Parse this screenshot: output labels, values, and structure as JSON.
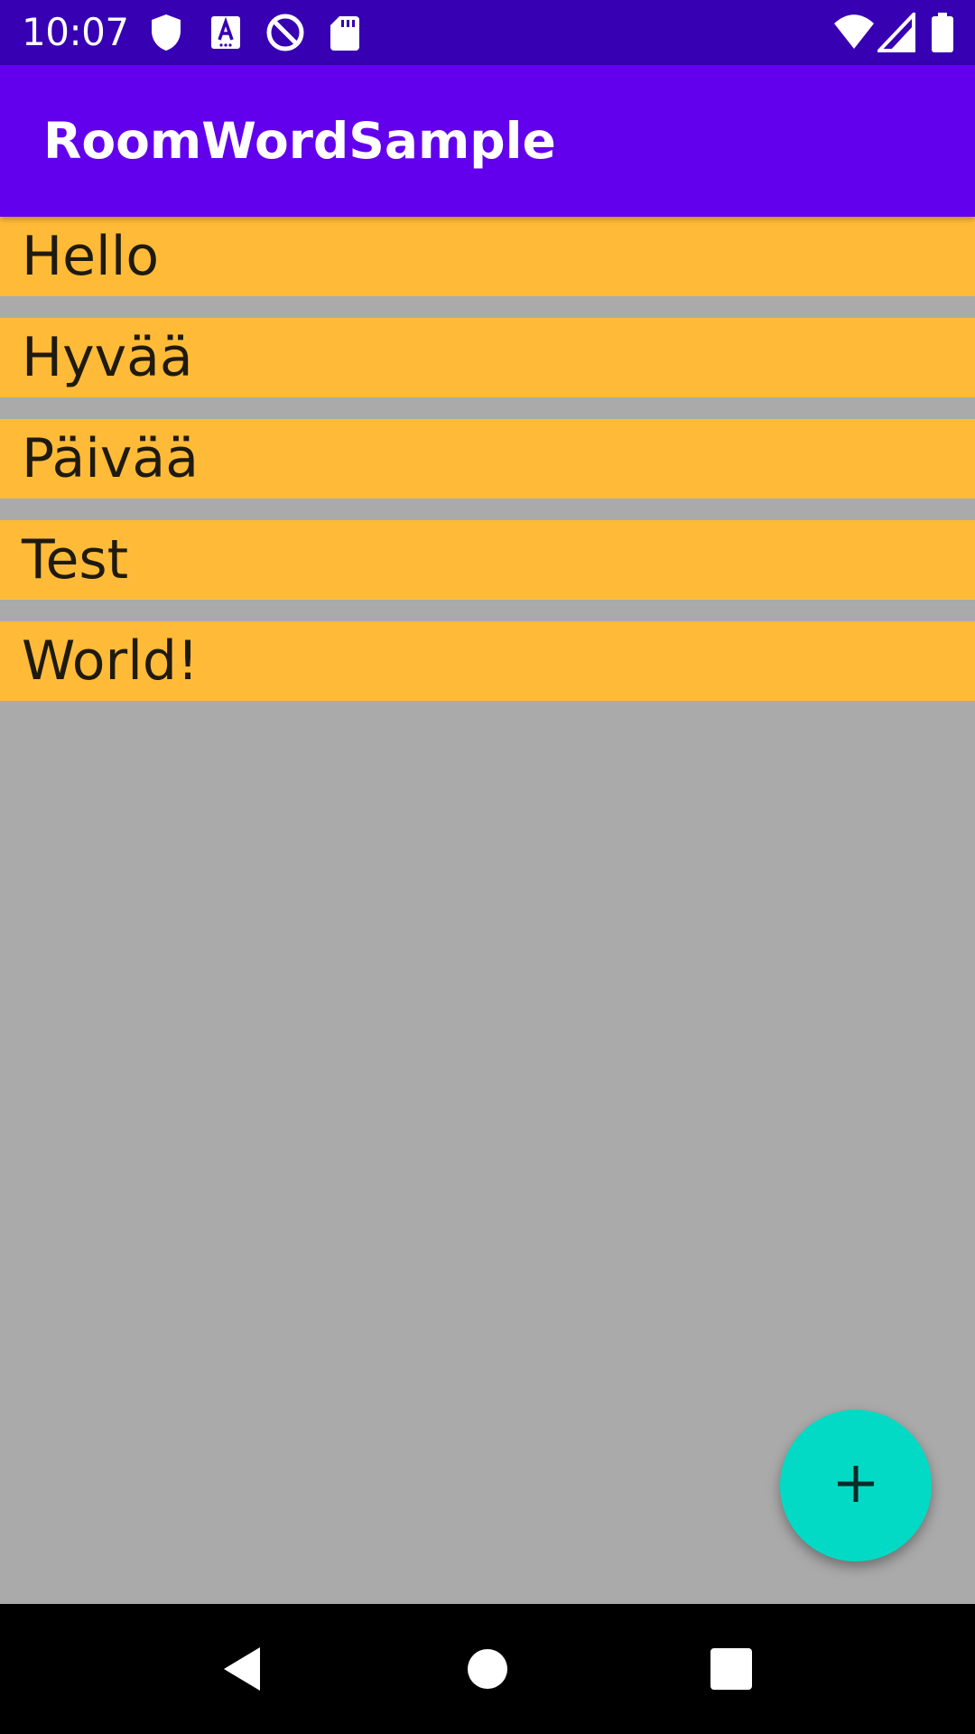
{
  "status_bar": {
    "time": "10:07",
    "left_icons": [
      "shield-icon",
      "font-a-icon",
      "sync-disabled-icon",
      "sd-card-icon"
    ],
    "right_icons": [
      "wifi-icon",
      "cell-signal-icon",
      "battery-icon"
    ]
  },
  "app_bar": {
    "title": "RoomWordSample"
  },
  "words": [
    "Hello",
    "Hyvää",
    "Päivää",
    "Test",
    "World!"
  ],
  "fab": {
    "icon": "add-icon"
  },
  "nav_bar": {
    "buttons": [
      "back-icon",
      "home-icon",
      "recents-icon"
    ]
  },
  "colors": {
    "status_bar": "#3700b3",
    "app_bar": "#6200ee",
    "list_item": "#ffbb38",
    "background": "#aaaaaa",
    "fab": "#03dac5"
  }
}
